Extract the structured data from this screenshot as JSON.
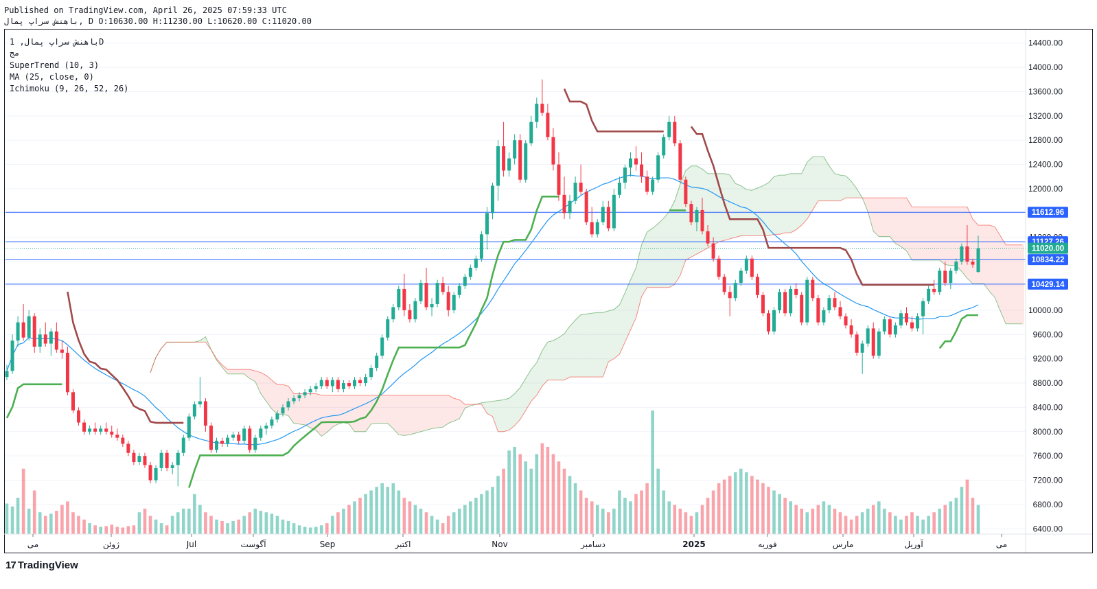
{
  "header": {
    "published": "Published on TradingView.com, April 26, 2025 07:59:33 UTC",
    "symbol_line": "باهنش سراپ  پمال, D O:10630.00 H:11230.00 L:10620.00 C:11020.00"
  },
  "legend": {
    "symbol": "باهنش سراپ  پمال, 1D",
    "exchange": "مج",
    "indicators": [
      "SuperTrend (10, 3)",
      "MA (25, close, 0)",
      "Ichimoku (9, 26, 52, 26)"
    ]
  },
  "branding": {
    "logo_text": "TradingView",
    "logo_mark": "17"
  },
  "chart_data": {
    "type": "candlestick",
    "title": "باهنش سراپ  پمال, 1D",
    "ylim": [
      6200,
      14600
    ],
    "y_ticks": [
      6400,
      6800,
      7200,
      7600,
      8000,
      8400,
      8800,
      9200,
      9600,
      10000,
      10400,
      10800,
      11200,
      11600,
      12000,
      12400,
      12800,
      13200,
      13600,
      14000,
      14400
    ],
    "y_tick_labels": [
      "6400.00",
      "6800.00",
      "7200.00",
      "7600.00",
      "8000.00",
      "8400.00",
      "8800.00",
      "9200.00",
      "9600.00",
      "10000.00",
      "10400.00",
      "10800.00",
      "11200.00",
      "11600.00",
      "12000.00",
      "12400.00",
      "12800.00",
      "13200.00",
      "13600.00",
      "14000.00",
      "14400.00"
    ],
    "x_labels": [
      "می",
      "ژوئن",
      "Jul",
      "آگوست",
      "Sep",
      "اکتبر",
      "Nov",
      "دسامبر",
      "2025",
      "فوریه",
      "مارس",
      "آوریل",
      "می"
    ],
    "horizontal_levels": [
      {
        "value": 11612.96,
        "label": "11612.96",
        "color": "#2962ff"
      },
      {
        "value": 11127.26,
        "label": "11127.26",
        "color": "#2962ff"
      },
      {
        "value": 11020.0,
        "label": "11020.00",
        "color": "#22ab94",
        "dotted": true
      },
      {
        "value": 10834.22,
        "label": "10834.22",
        "color": "#2962ff"
      },
      {
        "value": 10429.14,
        "label": "10429.14",
        "color": "#2962ff"
      }
    ],
    "ohlc": [
      [
        8900,
        9100,
        8850,
        9000
      ],
      [
        9000,
        9600,
        8950,
        9500
      ],
      [
        9500,
        9900,
        9400,
        9800
      ],
      [
        9800,
        10100,
        9500,
        9550
      ],
      [
        9550,
        10000,
        9500,
        9900
      ],
      [
        9900,
        9950,
        9300,
        9400
      ],
      [
        9400,
        9700,
        9300,
        9600
      ],
      [
        9600,
        9800,
        9400,
        9450
      ],
      [
        9450,
        9700,
        9250,
        9650
      ],
      [
        9650,
        9800,
        9300,
        9350
      ],
      [
        9350,
        9500,
        9200,
        9300
      ],
      [
        9300,
        9400,
        8600,
        8650
      ],
      [
        8650,
        8700,
        8300,
        8350
      ],
      [
        8350,
        8400,
        8100,
        8150
      ],
      [
        8150,
        8200,
        7950,
        8000
      ],
      [
        8000,
        8100,
        7950,
        8050
      ],
      [
        8050,
        8150,
        7950,
        8000
      ],
      [
        8000,
        8100,
        7950,
        8050
      ],
      [
        8050,
        8150,
        7950,
        8000
      ],
      [
        8000,
        8100,
        7900,
        7950
      ],
      [
        7950,
        8050,
        7850,
        7900
      ],
      [
        7900,
        7950,
        7750,
        7800
      ],
      [
        7800,
        7850,
        7600,
        7650
      ],
      [
        7650,
        7700,
        7450,
        7500
      ],
      [
        7500,
        7650,
        7450,
        7600
      ],
      [
        7600,
        7650,
        7400,
        7450
      ],
      [
        7450,
        7500,
        7150,
        7200
      ],
      [
        7200,
        7450,
        7150,
        7400
      ],
      [
        7400,
        7700,
        7350,
        7650
      ],
      [
        7650,
        7700,
        7350,
        7400
      ],
      [
        7400,
        7500,
        7300,
        7450
      ],
      [
        7450,
        7700,
        7100,
        7650
      ],
      [
        7650,
        7950,
        7600,
        7900
      ],
      [
        7900,
        8300,
        7850,
        8250
      ],
      [
        8250,
        8500,
        8200,
        8450
      ],
      [
        8450,
        8900,
        8400,
        8500
      ],
      [
        8500,
        8550,
        8000,
        8100
      ],
      [
        8100,
        8150,
        7650,
        7700
      ],
      [
        7700,
        7900,
        7650,
        7850
      ],
      [
        7850,
        7900,
        7750,
        7800
      ],
      [
        7800,
        7950,
        7750,
        7900
      ],
      [
        7900,
        8000,
        7850,
        7950
      ],
      [
        7950,
        8000,
        7800,
        7850
      ],
      [
        7850,
        8100,
        7800,
        8050
      ],
      [
        8050,
        8100,
        7650,
        7700
      ],
      [
        7700,
        7950,
        7650,
        7900
      ],
      [
        7900,
        8100,
        7850,
        8050
      ],
      [
        8050,
        8150,
        7950,
        8100
      ],
      [
        8100,
        8250,
        8050,
        8200
      ],
      [
        8200,
        8350,
        8150,
        8300
      ],
      [
        8300,
        8450,
        8250,
        8400
      ],
      [
        8400,
        8550,
        8350,
        8500
      ],
      [
        8500,
        8600,
        8450,
        8550
      ],
      [
        8550,
        8650,
        8500,
        8600
      ],
      [
        8600,
        8700,
        8550,
        8650
      ],
      [
        8650,
        8750,
        8600,
        8700
      ],
      [
        8700,
        8800,
        8650,
        8750
      ],
      [
        8750,
        8900,
        8700,
        8850
      ],
      [
        8850,
        8900,
        8700,
        8750
      ],
      [
        8750,
        8900,
        8650,
        8850
      ],
      [
        8850,
        8900,
        8650,
        8700
      ],
      [
        8700,
        8850,
        8650,
        8800
      ],
      [
        8800,
        8850,
        8700,
        8750
      ],
      [
        8750,
        8900,
        8700,
        8850
      ],
      [
        8850,
        8900,
        8750,
        8800
      ],
      [
        8800,
        8950,
        8750,
        8900
      ],
      [
        8900,
        9100,
        8850,
        9050
      ],
      [
        9050,
        9300,
        9000,
        9250
      ],
      [
        9250,
        9600,
        9200,
        9550
      ],
      [
        9550,
        9900,
        9500,
        9850
      ],
      [
        9850,
        10100,
        9800,
        10050
      ],
      [
        10050,
        10400,
        10000,
        10350
      ],
      [
        10350,
        10600,
        9900,
        10000
      ],
      [
        10000,
        10100,
        9800,
        9850
      ],
      [
        9850,
        10200,
        9800,
        10150
      ],
      [
        10150,
        10500,
        10100,
        10450
      ],
      [
        10450,
        10700,
        10000,
        10050
      ],
      [
        10050,
        10200,
        9900,
        10100
      ],
      [
        10100,
        10500,
        10050,
        10450
      ],
      [
        10450,
        10550,
        10250,
        10300
      ],
      [
        10300,
        10400,
        9900,
        10000
      ],
      [
        10000,
        10300,
        9950,
        10250
      ],
      [
        10250,
        10450,
        10200,
        10400
      ],
      [
        10400,
        10600,
        10350,
        10550
      ],
      [
        10550,
        10750,
        10500,
        10700
      ],
      [
        10700,
        10900,
        10650,
        10850
      ],
      [
        10850,
        11300,
        10800,
        11250
      ],
      [
        11250,
        11700,
        11000,
        11600
      ],
      [
        11600,
        12100,
        11500,
        12050
      ],
      [
        12050,
        12800,
        11800,
        12700
      ],
      [
        12700,
        13100,
        12200,
        12300
      ],
      [
        12300,
        12600,
        12200,
        12500
      ],
      [
        12500,
        12900,
        12400,
        12800
      ],
      [
        12800,
        12900,
        12100,
        12150
      ],
      [
        12150,
        12800,
        12100,
        12750
      ],
      [
        12750,
        13200,
        12700,
        13100
      ],
      [
        13100,
        13500,
        13000,
        13400
      ],
      [
        13400,
        13800,
        13200,
        13250
      ],
      [
        13250,
        13400,
        12800,
        12850
      ],
      [
        12850,
        13000,
        12300,
        12400
      ],
      [
        12400,
        12600,
        11800,
        11900
      ],
      [
        11900,
        12200,
        11500,
        11600
      ],
      [
        11600,
        11900,
        11500,
        11800
      ],
      [
        11800,
        12200,
        11750,
        12100
      ],
      [
        12100,
        12400,
        11900,
        11950
      ],
      [
        11950,
        12000,
        11400,
        11450
      ],
      [
        11450,
        11700,
        11200,
        11250
      ],
      [
        11250,
        11500,
        11200,
        11450
      ],
      [
        11450,
        11800,
        11400,
        11700
      ],
      [
        11700,
        11800,
        11300,
        11350
      ],
      [
        11350,
        12000,
        11300,
        11900
      ],
      [
        11900,
        12200,
        11850,
        12100
      ],
      [
        12100,
        12400,
        12000,
        12350
      ],
      [
        12350,
        12600,
        12200,
        12500
      ],
      [
        12500,
        12700,
        12300,
        12400
      ],
      [
        12400,
        12600,
        12100,
        12200
      ],
      [
        12200,
        12300,
        11900,
        11950
      ],
      [
        11950,
        12200,
        11900,
        12150
      ],
      [
        12150,
        12600,
        12100,
        12550
      ],
      [
        12550,
        12900,
        12500,
        12850
      ],
      [
        12850,
        13200,
        12800,
        13100
      ],
      [
        13100,
        13200,
        12700,
        12750
      ],
      [
        12750,
        12800,
        12100,
        12150
      ],
      [
        12150,
        12200,
        11700,
        11750
      ],
      [
        11750,
        11800,
        11400,
        11450
      ],
      [
        11450,
        11700,
        11300,
        11650
      ],
      [
        11650,
        11850,
        11250,
        11300
      ],
      [
        11300,
        11400,
        11050,
        11100
      ],
      [
        11100,
        11200,
        10800,
        10850
      ],
      [
        10850,
        10900,
        10500,
        10550
      ],
      [
        10550,
        10600,
        10250,
        10300
      ],
      [
        10300,
        10400,
        9900,
        10200
      ],
      [
        10200,
        10500,
        10150,
        10450
      ],
      [
        10450,
        10700,
        10400,
        10650
      ],
      [
        10650,
        10900,
        10600,
        10850
      ],
      [
        10850,
        10900,
        10500,
        10550
      ],
      [
        10550,
        10600,
        10200,
        10250
      ],
      [
        10250,
        10300,
        9900,
        9950
      ],
      [
        9950,
        10000,
        9600,
        9650
      ],
      [
        9650,
        10050,
        9600,
        10000
      ],
      [
        10000,
        10350,
        9950,
        10300
      ],
      [
        10300,
        10350,
        9900,
        9950
      ],
      [
        9950,
        10400,
        9900,
        10350
      ],
      [
        10350,
        10450,
        10200,
        10250
      ],
      [
        10250,
        10300,
        9750,
        9800
      ],
      [
        9800,
        10550,
        9750,
        10500
      ],
      [
        10500,
        10550,
        10150,
        10200
      ],
      [
        10200,
        10250,
        9750,
        9800
      ],
      [
        9800,
        10050,
        9750,
        10000
      ],
      [
        10000,
        10250,
        9950,
        10200
      ],
      [
        10200,
        10300,
        10000,
        10050
      ],
      [
        10050,
        10150,
        9850,
        9900
      ],
      [
        9900,
        9950,
        9700,
        9750
      ],
      [
        9750,
        9850,
        9550,
        9600
      ],
      [
        9600,
        9650,
        9250,
        9300
      ],
      [
        9300,
        9500,
        8950,
        9450
      ],
      [
        9450,
        9750,
        9400,
        9700
      ],
      [
        9700,
        9800,
        9200,
        9250
      ],
      [
        9250,
        9700,
        9200,
        9650
      ],
      [
        9650,
        9900,
        9600,
        9850
      ],
      [
        9850,
        9900,
        9550,
        9600
      ],
      [
        9600,
        9800,
        9550,
        9750
      ],
      [
        9750,
        10000,
        9700,
        9950
      ],
      [
        9950,
        10050,
        9750,
        9800
      ],
      [
        9800,
        9900,
        9650,
        9700
      ],
      [
        9700,
        9950,
        9650,
        9900
      ],
      [
        9900,
        10200,
        9600,
        10150
      ],
      [
        10150,
        10400,
        10100,
        10350
      ],
      [
        10350,
        10500,
        10250,
        10300
      ],
      [
        10300,
        10700,
        10250,
        10650
      ],
      [
        10650,
        10800,
        10400,
        10450
      ],
      [
        10450,
        10700,
        10350,
        10650
      ],
      [
        10650,
        10850,
        10600,
        10800
      ],
      [
        10800,
        11100,
        10750,
        11050
      ],
      [
        11050,
        11400,
        10750,
        10800
      ],
      [
        10800,
        10850,
        10700,
        10750
      ],
      [
        10630,
        11230,
        10620,
        11020
      ]
    ],
    "volume": [
      420,
      380,
      500,
      900,
      350,
      600,
      300,
      250,
      280,
      320,
      400,
      450,
      300,
      250,
      200,
      150,
      120,
      100,
      110,
      130,
      100,
      90,
      110,
      120,
      300,
      350,
      250,
      200,
      150,
      120,
      250,
      300,
      350,
      350,
      550,
      400,
      300,
      250,
      200,
      180,
      150,
      180,
      200,
      250,
      300,
      350,
      320,
      300,
      280,
      250,
      200,
      180,
      150,
      120,
      100,
      90,
      100,
      120,
      150,
      250,
      300,
      350,
      400,
      450,
      500,
      550,
      600,
      650,
      700,
      650,
      700,
      600,
      500,
      450,
      400,
      350,
      300,
      250,
      200,
      150,
      250,
      300,
      350,
      400,
      450,
      500,
      550,
      600,
      650,
      800,
      900,
      1150,
      1200,
      1100,
      1000,
      900,
      1100,
      1250,
      1200,
      1100,
      1000,
      900,
      800,
      700,
      600,
      500,
      450,
      400,
      350,
      300,
      350,
      600,
      500,
      450,
      550,
      600,
      700,
      1700,
      900,
      600,
      450,
      400,
      350,
      300,
      250,
      300,
      400,
      500,
      600,
      700,
      750,
      800,
      850,
      900,
      850,
      800,
      750,
      700,
      650,
      600,
      550,
      500,
      450,
      400,
      350,
      300,
      350,
      400,
      450,
      400,
      350,
      300,
      250,
      200,
      250,
      300,
      350,
      400,
      450,
      350,
      300,
      250,
      200,
      250,
      300,
      250,
      200,
      250,
      300,
      350,
      400,
      450,
      500,
      650,
      750,
      500,
      400,
      450,
      500,
      300,
      250
    ]
  }
}
